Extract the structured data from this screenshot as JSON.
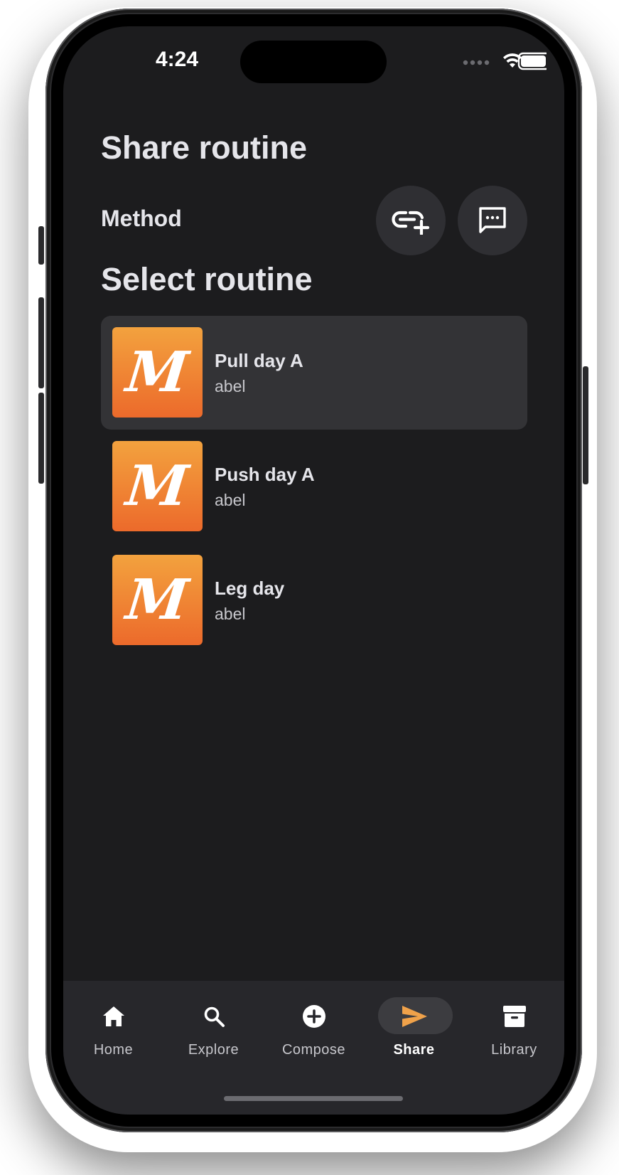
{
  "status_bar": {
    "time": "4:24"
  },
  "page": {
    "title": "Share routine",
    "method_label": "Method",
    "select_title": "Select routine"
  },
  "method_buttons": [
    {
      "name": "add-link-icon"
    },
    {
      "name": "message-icon"
    }
  ],
  "routines": [
    {
      "title": "Pull day A",
      "author": "abel",
      "thumb_letter": "M",
      "selected": true
    },
    {
      "title": "Push day A",
      "author": "abel",
      "thumb_letter": "M",
      "selected": false
    },
    {
      "title": "Leg day",
      "author": "abel",
      "thumb_letter": "M",
      "selected": false
    }
  ],
  "tabs": [
    {
      "label": "Home",
      "icon": "home-icon",
      "active": false
    },
    {
      "label": "Explore",
      "icon": "search-icon",
      "active": false
    },
    {
      "label": "Compose",
      "icon": "plus-circle-icon",
      "active": false
    },
    {
      "label": "Share",
      "icon": "send-icon",
      "active": true
    },
    {
      "label": "Library",
      "icon": "archive-icon",
      "active": false
    }
  ],
  "colors": {
    "accent": "#f0a24a",
    "background": "#1c1c1e",
    "selected_row": "#333336",
    "thumb_top": "#f3a23e",
    "thumb_bottom": "#ec6a2b"
  }
}
